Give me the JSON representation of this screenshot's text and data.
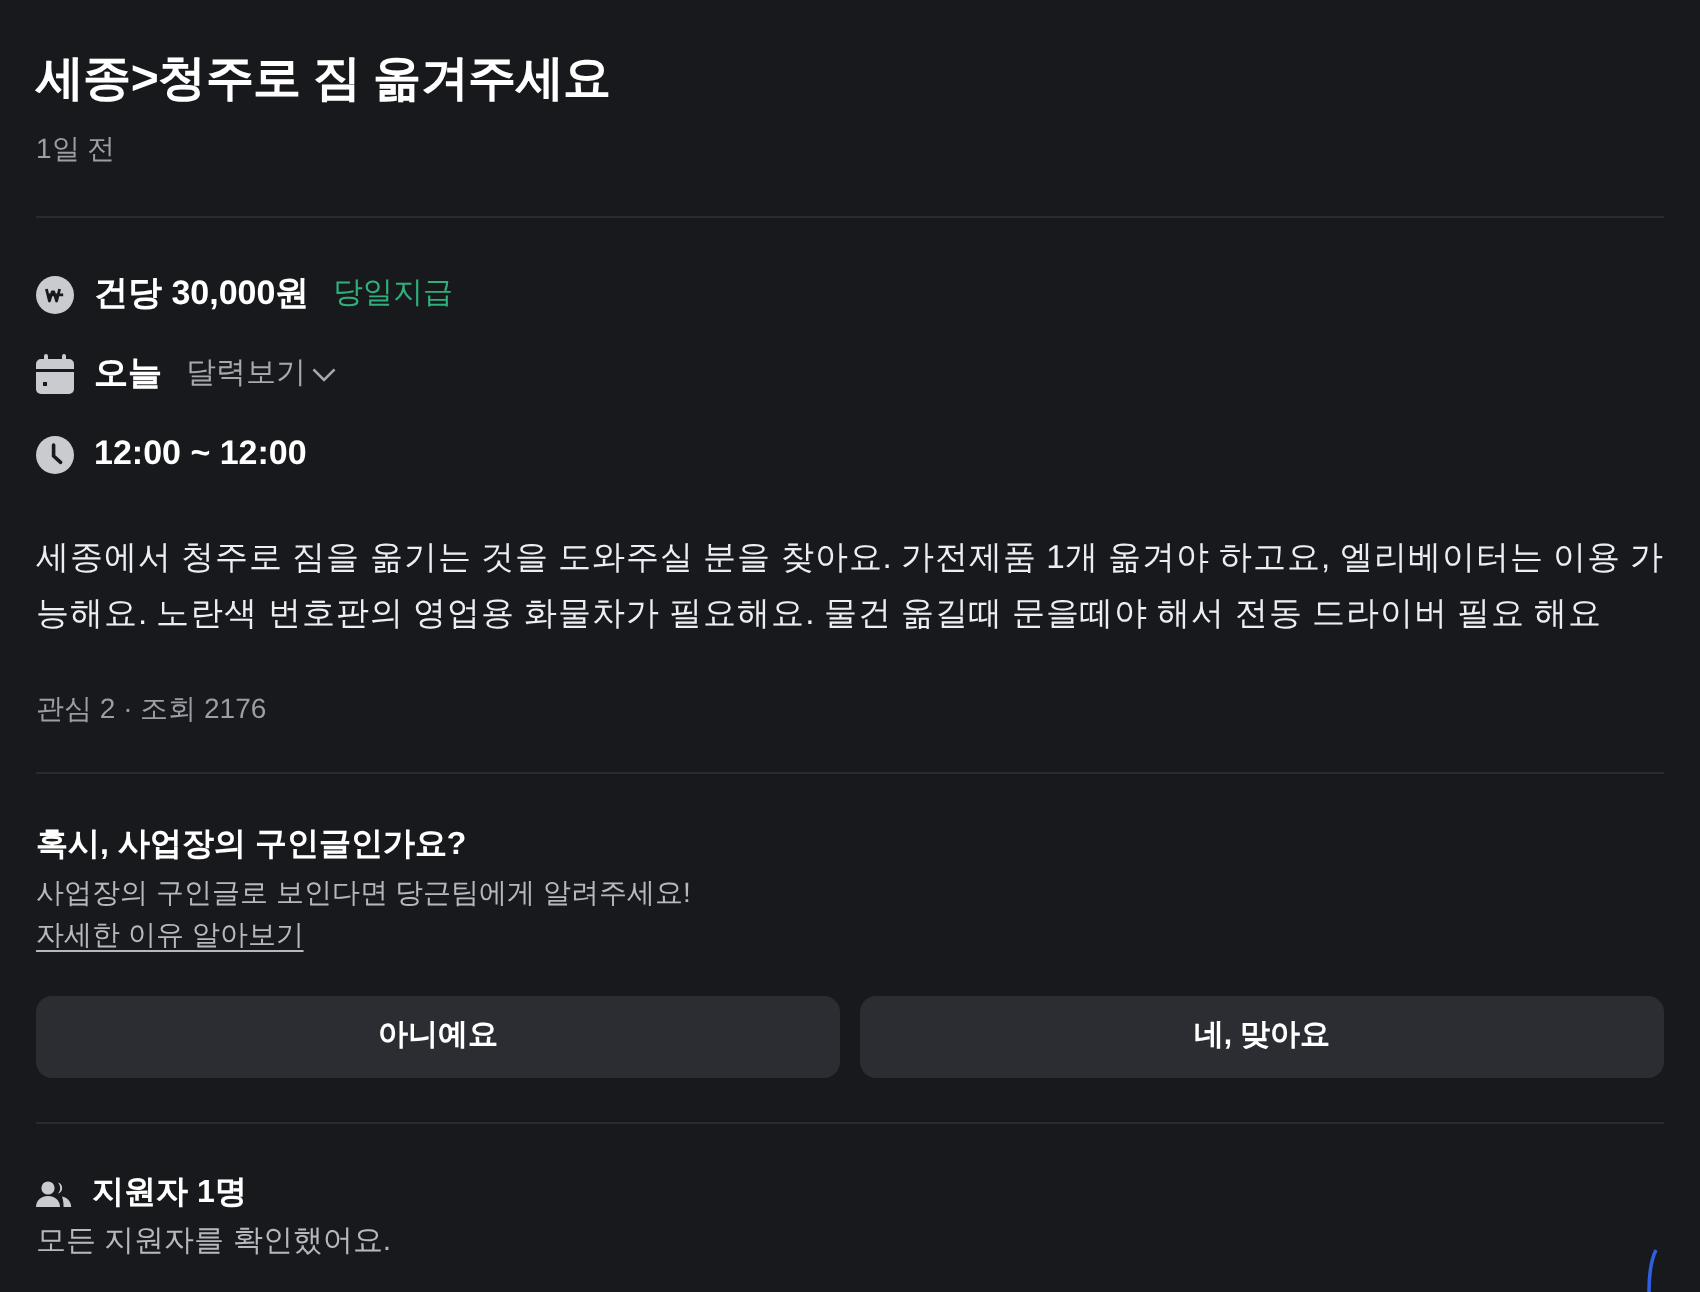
{
  "post": {
    "title": "세종>청주로 짐 옮겨주세요",
    "posted": "1일 전"
  },
  "details": [
    {
      "kind": "pay",
      "text": "건당 30,000원",
      "tag": "당일지급"
    },
    {
      "kind": "date",
      "text": "오늘",
      "link": "달력보기"
    },
    {
      "kind": "time",
      "text": "12:00 ~ 12:00"
    }
  ],
  "description": "세종에서 청주로 짐을 옮기는 것을 도와주실 분을 찾아요. 가전제품 1개 옮겨야 하고요, 엘리베이터는 이용 가능해요. 노란색 번호판의 영업용 화물차가 필요해요. 물건 옮길때 문을떼야 해서 전동 드라이버 필요 해요",
  "stats": "관심 2 · 조회 2176",
  "notice": {
    "title": "혹시, 사업장의 구인글인가요?",
    "text": "사업장의 구인글로 보인다면 당근팀에게 알려주세요!",
    "link": "자세한 이유 알아보기"
  },
  "buttons": [
    "아니예요",
    "네, 맞아요"
  ],
  "applicants": {
    "title": "지원자 1명",
    "text": "모든 지원자를 확인했어요."
  }
}
